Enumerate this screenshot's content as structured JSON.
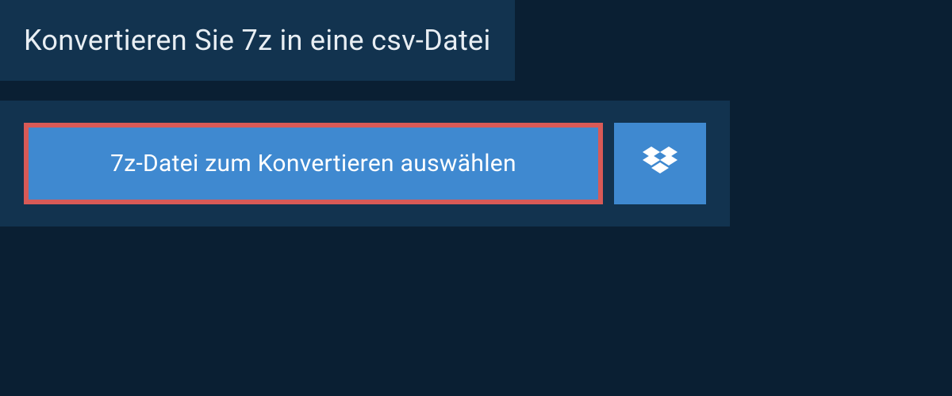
{
  "header": {
    "title": "Konvertieren Sie 7z in eine csv-Datei"
  },
  "upload": {
    "select_label": "7z-Datei zum Konvertieren auswählen"
  },
  "colors": {
    "background": "#0a1f33",
    "panel": "#12334f",
    "button": "#3f89d0",
    "highlight_border": "#d85a57"
  }
}
